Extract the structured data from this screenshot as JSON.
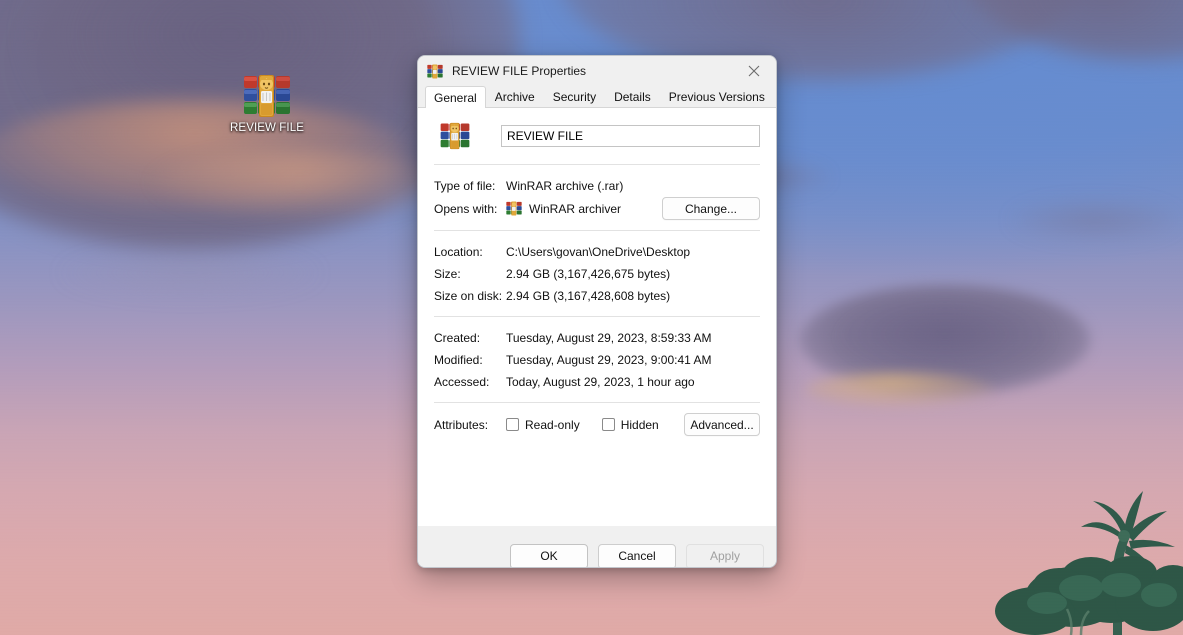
{
  "desktop": {
    "icon": {
      "label": "REVIEW FILE",
      "icon_name": "winrar-archive-icon"
    },
    "wallpaper": {
      "description": "sunset sky with clouds and palm trees",
      "sky_top_color": "#6f89c4",
      "sky_bottom_color": "#e0a9a6",
      "cloud_color": "#706885",
      "cloud_rim_color": "#c9927b",
      "foliage_color": "#2d5245"
    }
  },
  "dialog": {
    "title": "REVIEW FILE Properties",
    "title_icon": "winrar-archive-icon",
    "close_label": "Close",
    "tabs": [
      {
        "label": "General",
        "active": true
      },
      {
        "label": "Archive",
        "active": false
      },
      {
        "label": "Security",
        "active": false
      },
      {
        "label": "Details",
        "active": false
      },
      {
        "label": "Previous Versions",
        "active": false
      }
    ],
    "general": {
      "filename_value": "REVIEW FILE",
      "filename_placeholder": "",
      "type_of_file_label": "Type of file:",
      "type_of_file_value": "WinRAR archive (.rar)",
      "opens_with_label": "Opens with:",
      "opens_with_value": "WinRAR archiver",
      "opens_with_icon": "winrar-archive-icon",
      "change_button": "Change...",
      "location_label": "Location:",
      "location_value": "C:\\Users\\govan\\OneDrive\\Desktop",
      "size_label": "Size:",
      "size_value": "2.94 GB (3,167,426,675 bytes)",
      "size_on_disk_label": "Size on disk:",
      "size_on_disk_value": "2.94 GB (3,167,428,608 bytes)",
      "created_label": "Created:",
      "created_value": "Tuesday, August 29, 2023, 8:59:33 AM",
      "modified_label": "Modified:",
      "modified_value": "Tuesday, August 29, 2023, 9:00:41 AM",
      "accessed_label": "Accessed:",
      "accessed_value": "Today, August 29, 2023, 1 hour ago",
      "attributes_label": "Attributes:",
      "readonly_label": "Read-only",
      "readonly_checked": false,
      "hidden_label": "Hidden",
      "hidden_checked": false,
      "advanced_button": "Advanced..."
    },
    "footer": {
      "ok_label": "OK",
      "cancel_label": "Cancel",
      "apply_label": "Apply",
      "apply_disabled": true
    }
  }
}
